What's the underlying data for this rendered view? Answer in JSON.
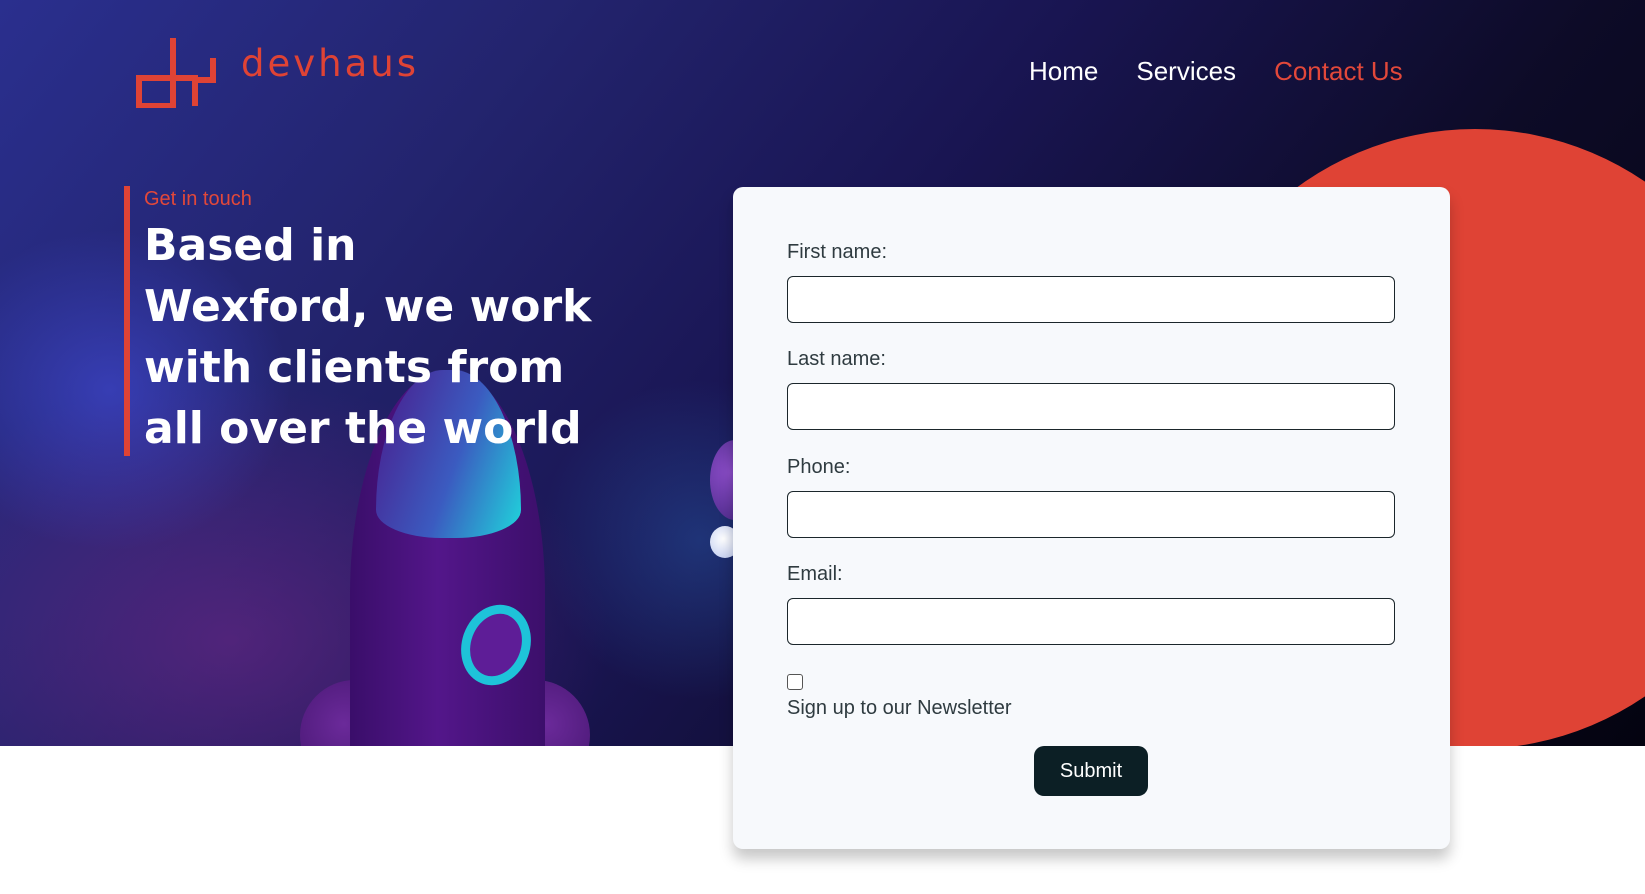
{
  "brand": {
    "name": "devhaus",
    "logo_icon": "devhaus-logo-icon",
    "accent_color": "#df4335"
  },
  "nav": {
    "items": [
      {
        "label": "Home",
        "active": false
      },
      {
        "label": "Services",
        "active": false
      },
      {
        "label": "Contact Us",
        "active": true
      }
    ]
  },
  "intro": {
    "kicker": "Get in touch",
    "title": "Based in Wexford, we work with clients from all over the world"
  },
  "form": {
    "first_name": {
      "label": "First name:",
      "value": ""
    },
    "last_name": {
      "label": "Last name:",
      "value": ""
    },
    "phone": {
      "label": "Phone:",
      "value": ""
    },
    "email": {
      "label": "Email:",
      "value": ""
    },
    "newsletter": {
      "label": "Sign up to our Newsletter",
      "checked": false
    },
    "submit_label": "Submit"
  },
  "colors": {
    "hero_background": "#1b1a5c",
    "accent": "#df4335",
    "button": "#0c1f25",
    "card": "#f7f9fc"
  }
}
